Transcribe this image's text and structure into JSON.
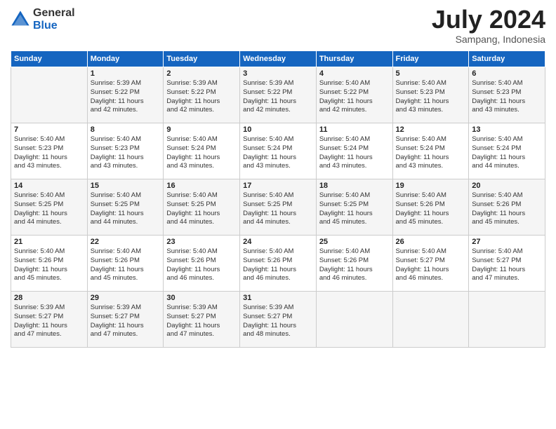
{
  "logo": {
    "general": "General",
    "blue": "Blue"
  },
  "title": {
    "month_year": "July 2024",
    "location": "Sampang, Indonesia"
  },
  "weekdays": [
    "Sunday",
    "Monday",
    "Tuesday",
    "Wednesday",
    "Thursday",
    "Friday",
    "Saturday"
  ],
  "weeks": [
    [
      {
        "day": "",
        "info": ""
      },
      {
        "day": "1",
        "info": "Sunrise: 5:39 AM\nSunset: 5:22 PM\nDaylight: 11 hours\nand 42 minutes."
      },
      {
        "day": "2",
        "info": "Sunrise: 5:39 AM\nSunset: 5:22 PM\nDaylight: 11 hours\nand 42 minutes."
      },
      {
        "day": "3",
        "info": "Sunrise: 5:39 AM\nSunset: 5:22 PM\nDaylight: 11 hours\nand 42 minutes."
      },
      {
        "day": "4",
        "info": "Sunrise: 5:40 AM\nSunset: 5:22 PM\nDaylight: 11 hours\nand 42 minutes."
      },
      {
        "day": "5",
        "info": "Sunrise: 5:40 AM\nSunset: 5:23 PM\nDaylight: 11 hours\nand 43 minutes."
      },
      {
        "day": "6",
        "info": "Sunrise: 5:40 AM\nSunset: 5:23 PM\nDaylight: 11 hours\nand 43 minutes."
      }
    ],
    [
      {
        "day": "7",
        "info": "Sunrise: 5:40 AM\nSunset: 5:23 PM\nDaylight: 11 hours\nand 43 minutes."
      },
      {
        "day": "8",
        "info": "Sunrise: 5:40 AM\nSunset: 5:23 PM\nDaylight: 11 hours\nand 43 minutes."
      },
      {
        "day": "9",
        "info": "Sunrise: 5:40 AM\nSunset: 5:24 PM\nDaylight: 11 hours\nand 43 minutes."
      },
      {
        "day": "10",
        "info": "Sunrise: 5:40 AM\nSunset: 5:24 PM\nDaylight: 11 hours\nand 43 minutes."
      },
      {
        "day": "11",
        "info": "Sunrise: 5:40 AM\nSunset: 5:24 PM\nDaylight: 11 hours\nand 43 minutes."
      },
      {
        "day": "12",
        "info": "Sunrise: 5:40 AM\nSunset: 5:24 PM\nDaylight: 11 hours\nand 43 minutes."
      },
      {
        "day": "13",
        "info": "Sunrise: 5:40 AM\nSunset: 5:24 PM\nDaylight: 11 hours\nand 44 minutes."
      }
    ],
    [
      {
        "day": "14",
        "info": "Sunrise: 5:40 AM\nSunset: 5:25 PM\nDaylight: 11 hours\nand 44 minutes."
      },
      {
        "day": "15",
        "info": "Sunrise: 5:40 AM\nSunset: 5:25 PM\nDaylight: 11 hours\nand 44 minutes."
      },
      {
        "day": "16",
        "info": "Sunrise: 5:40 AM\nSunset: 5:25 PM\nDaylight: 11 hours\nand 44 minutes."
      },
      {
        "day": "17",
        "info": "Sunrise: 5:40 AM\nSunset: 5:25 PM\nDaylight: 11 hours\nand 44 minutes."
      },
      {
        "day": "18",
        "info": "Sunrise: 5:40 AM\nSunset: 5:25 PM\nDaylight: 11 hours\nand 45 minutes."
      },
      {
        "day": "19",
        "info": "Sunrise: 5:40 AM\nSunset: 5:26 PM\nDaylight: 11 hours\nand 45 minutes."
      },
      {
        "day": "20",
        "info": "Sunrise: 5:40 AM\nSunset: 5:26 PM\nDaylight: 11 hours\nand 45 minutes."
      }
    ],
    [
      {
        "day": "21",
        "info": "Sunrise: 5:40 AM\nSunset: 5:26 PM\nDaylight: 11 hours\nand 45 minutes."
      },
      {
        "day": "22",
        "info": "Sunrise: 5:40 AM\nSunset: 5:26 PM\nDaylight: 11 hours\nand 45 minutes."
      },
      {
        "day": "23",
        "info": "Sunrise: 5:40 AM\nSunset: 5:26 PM\nDaylight: 11 hours\nand 46 minutes."
      },
      {
        "day": "24",
        "info": "Sunrise: 5:40 AM\nSunset: 5:26 PM\nDaylight: 11 hours\nand 46 minutes."
      },
      {
        "day": "25",
        "info": "Sunrise: 5:40 AM\nSunset: 5:26 PM\nDaylight: 11 hours\nand 46 minutes."
      },
      {
        "day": "26",
        "info": "Sunrise: 5:40 AM\nSunset: 5:27 PM\nDaylight: 11 hours\nand 46 minutes."
      },
      {
        "day": "27",
        "info": "Sunrise: 5:40 AM\nSunset: 5:27 PM\nDaylight: 11 hours\nand 47 minutes."
      }
    ],
    [
      {
        "day": "28",
        "info": "Sunrise: 5:39 AM\nSunset: 5:27 PM\nDaylight: 11 hours\nand 47 minutes."
      },
      {
        "day": "29",
        "info": "Sunrise: 5:39 AM\nSunset: 5:27 PM\nDaylight: 11 hours\nand 47 minutes."
      },
      {
        "day": "30",
        "info": "Sunrise: 5:39 AM\nSunset: 5:27 PM\nDaylight: 11 hours\nand 47 minutes."
      },
      {
        "day": "31",
        "info": "Sunrise: 5:39 AM\nSunset: 5:27 PM\nDaylight: 11 hours\nand 48 minutes."
      },
      {
        "day": "",
        "info": ""
      },
      {
        "day": "",
        "info": ""
      },
      {
        "day": "",
        "info": ""
      }
    ]
  ]
}
